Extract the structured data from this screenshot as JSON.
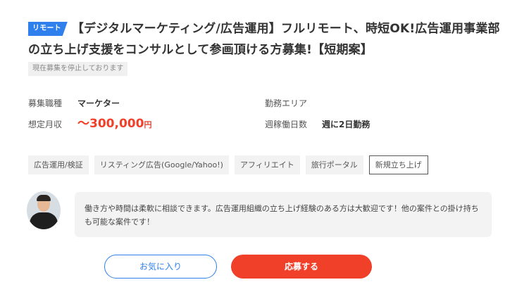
{
  "job": {
    "remote_badge": "リモート",
    "title": "【デジタルマーケティング/広告運用】フルリモート、時短OK!広告運用事業部の立ち上げ支援をコンサルとして参画頂ける方募集!【短期案】",
    "status": "現在募集を停止しております"
  },
  "info": {
    "job_type_label": "募集職種",
    "job_type_value": "マーケター",
    "salary_label": "想定月収",
    "salary_value": "〜300,000",
    "salary_unit": "円",
    "area_label": "勤務エリア",
    "area_value": "",
    "days_label": "週稼働日数",
    "days_value": "週に2日勤務"
  },
  "tags": [
    "広告運用/検証",
    "リスティング広告(Google/Yahoo!)",
    "アフィリエイト",
    "旅行ポータル",
    "新規立ち上げ"
  ],
  "message": "働き方や時間は柔軟に相談できます。広告運用組織の立ち上げ経験のある方は大歓迎です！他の案件との掛け持ちも可能な案件です！",
  "buttons": {
    "favorite": "お気に入り",
    "apply": "応募する"
  },
  "colors": {
    "accent_blue": "#2f80ed",
    "accent_red": "#f0402a"
  }
}
